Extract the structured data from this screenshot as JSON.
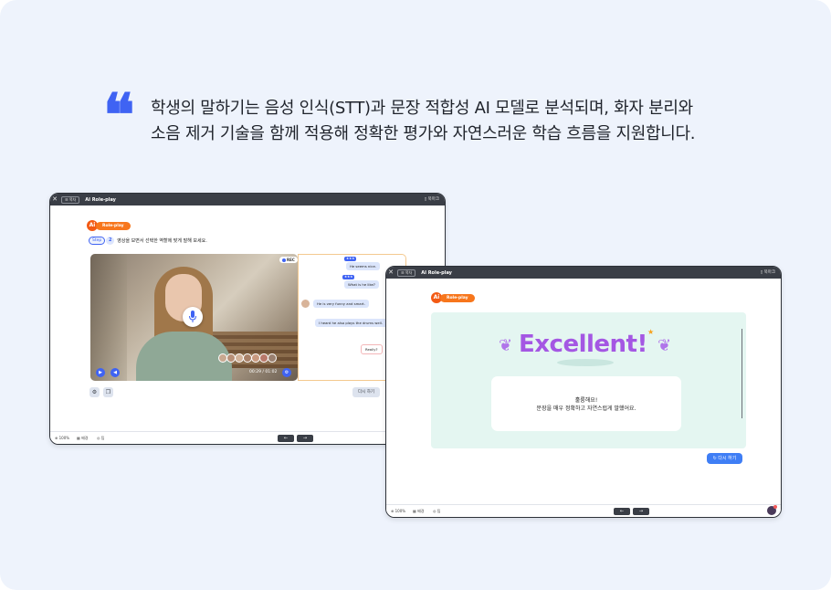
{
  "quote": {
    "mark": "❝",
    "line1": "학생의 말하기는 음성 인식(STT)과 문장 적합성 AI 모델로 분석되며, 화자 분리와",
    "line2": "소음 제거 기술을 함께 적용해 정확한 평가와 자연스러운 학습 흐름을 지원합니다."
  },
  "window1": {
    "title": "AI Role-play",
    "menu_label": "☰ 목차",
    "bookmark_label": "북마크",
    "badge": {
      "ai": "Ai",
      "label": "Role-play"
    },
    "step": {
      "label": "Step",
      "number": "2",
      "instruction": "영상을 보면서 선택한 역할에 맞게 말해 보세요."
    },
    "video": {
      "rec_label": "REC",
      "time": "00:29 / 01:02"
    },
    "chat": [
      {
        "type": "stars",
        "text": "★★★"
      },
      {
        "type": "bubble",
        "text": "He seems nice."
      },
      {
        "type": "stars",
        "text": "★★★"
      },
      {
        "type": "bubble",
        "text": "What is he like?"
      },
      {
        "type": "bubble",
        "text": "He is very funny and smart."
      },
      {
        "type": "bubble",
        "text": "I heard he also plays the drums well."
      },
      {
        "type": "bubble",
        "text": "Really?"
      }
    ],
    "retry_label": "다시 하기",
    "bottom": {
      "zoom": "100%",
      "layout": "배경",
      "help": "팁"
    },
    "nav": {
      "prev": "←",
      "next": "→"
    }
  },
  "window2": {
    "title": "AI Role-play",
    "menu_label": "☰ 목차",
    "bookmark_label": "북마크",
    "badge": {
      "ai": "Ai",
      "label": "Role-play"
    },
    "result": {
      "headline": "Excellent!",
      "message_line1": "훌륭해요!",
      "message_line2": "문장을 매우 정확하고 자연스럽게 말했어요."
    },
    "retry_label": "↻ 다시 하기",
    "bottom": {
      "zoom": "100%",
      "layout": "배경",
      "help": "팁"
    },
    "nav": {
      "prev": "←",
      "next": "→"
    }
  },
  "colors": {
    "accent_blue": "#3f63f3",
    "accent_orange": "#f7761c",
    "excellent_purple": "#a457e3",
    "panel_mint": "#e4f6f1",
    "titlebar_dark": "#3a3e46"
  }
}
